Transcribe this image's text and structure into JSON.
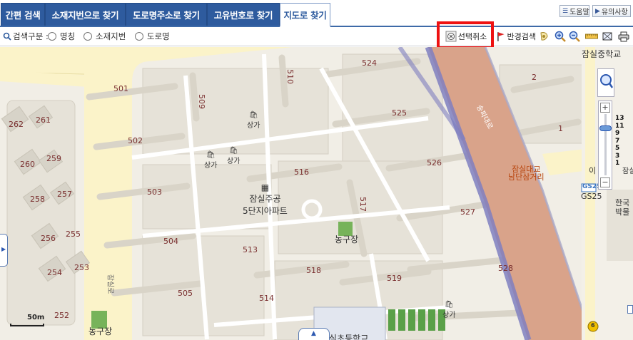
{
  "tabs": [
    {
      "label": "간편 검색",
      "active": false
    },
    {
      "label": "소재지번으로 찾기",
      "active": false
    },
    {
      "label": "도로명주소로 찾기",
      "active": false
    },
    {
      "label": "고유번호로 찾기",
      "active": false
    },
    {
      "label": "지도로 찾기",
      "active": true
    }
  ],
  "top_buttons": {
    "help": "도움말",
    "notice": "유의사항"
  },
  "search": {
    "label": "검색구분 :",
    "options": [
      "명칭",
      "소재지번",
      "도로명"
    ]
  },
  "toolbar": {
    "cancel_selection": "선택취소",
    "radius_search": "반경검색"
  },
  "map": {
    "lots": [
      "501",
      "502",
      "503",
      "504",
      "505",
      "509",
      "510",
      "513",
      "514",
      "516",
      "517",
      "518",
      "519",
      "524",
      "525",
      "526",
      "527",
      "528",
      "2",
      "1",
      "262",
      "261",
      "260",
      "259",
      "258",
      "257",
      "256",
      "255",
      "254",
      "253",
      "252"
    ],
    "poi": {
      "store": "상가",
      "apartment_line1": "잠실주공",
      "apartment_line2": "5단지아파트",
      "basketball": "농구장",
      "school_top": "잠실중학교",
      "intersection_line1": "잠실대교",
      "intersection_line2": "남단삼거리",
      "road_side": "잠실로",
      "road_bridge": "송파대로",
      "gs_brand": "GS25",
      "gs_text": "GS25",
      "korea_line1": "한국",
      "korea_line2": "박물",
      "partial_left": "이",
      "partial_right": "잠실",
      "school_bottom": "잠실초등학교",
      "bus_number": "6"
    },
    "zoom_levels": [
      "13",
      "11",
      "9",
      "7",
      "5",
      "3",
      "1"
    ],
    "scale": "50m"
  },
  "colors": {
    "tab_bg": "#2e5b9e",
    "highlight": "#ee1111",
    "major_road": "#d9a38a",
    "road_edge": "#7f7fbf"
  }
}
